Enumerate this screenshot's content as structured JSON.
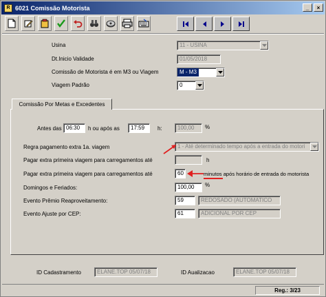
{
  "window": {
    "title": "6021 Comissão Motorista",
    "app_icon_text": "R"
  },
  "toolbar": {
    "buttons": [
      "new-icon",
      "edit-icon",
      "delete-icon",
      "confirm-icon",
      "undo-icon",
      "search-icon",
      "disk-icon",
      "print-icon",
      "keyboard-icon"
    ],
    "nav": [
      "first-icon",
      "prev-icon",
      "next-icon",
      "last-icon"
    ]
  },
  "form": {
    "usina_label": "Usina",
    "usina_value": "11 - USINA",
    "dt_label": "Dt.Inicio Validade",
    "dt_value": "01/05/2018",
    "comissao_label": "Comissão de Motorista é em M3 ou Viagem",
    "comissao_value": "M - M3",
    "viagem_label": "Viagem Padrão",
    "viagem_value": "0"
  },
  "tab": {
    "label": "Comissão Por Metas e Excedentes"
  },
  "panel": {
    "antes_label": "Antes das",
    "antes_value": "06:30",
    "apos_label": "h ou após as",
    "apos_value": "17:59",
    "h_label": "h:",
    "pct1_value": "100,00",
    "pct_symbol": "%",
    "regra_label": "Regra pagamento extra 1a. viagem",
    "regra_value": "1 - Até determinado tempo após a entrada do motori",
    "pagar1_label": "Pagar extra primeira viagem para carregamentos até",
    "pagar1_unit": "h",
    "pagar2_label": "Pagar extra primeira viagem para carregamentos até",
    "pagar2_value": "60",
    "pagar2_unit": "minutos após horário de entrada do motorista",
    "domingos_label": "Domingos e Feriados:",
    "domingos_value": "100,00",
    "premio_label": "Evento Prêmio Reaproveitamento:",
    "premio_code": "59",
    "premio_desc": "REDOSADO (AUTOMATICO",
    "ajuste_label": "Evento Ajuste por CEP:",
    "ajuste_code": "61",
    "ajuste_desc": "ADICIONAL POR CEP"
  },
  "footer": {
    "cad_label": "ID Cadastramento",
    "cad_value": "ELANE.TOP 05/07/18",
    "alt_label": "ID Aualizacao",
    "alt_value": "ELANE.TOP 05/07/18"
  },
  "status": {
    "reg": "Reg.: 3/23"
  },
  "colors": {
    "title_start": "#0a246a",
    "title_end": "#a6caf0",
    "window_bg": "#d4d0c8",
    "arrow": "#e02020"
  }
}
